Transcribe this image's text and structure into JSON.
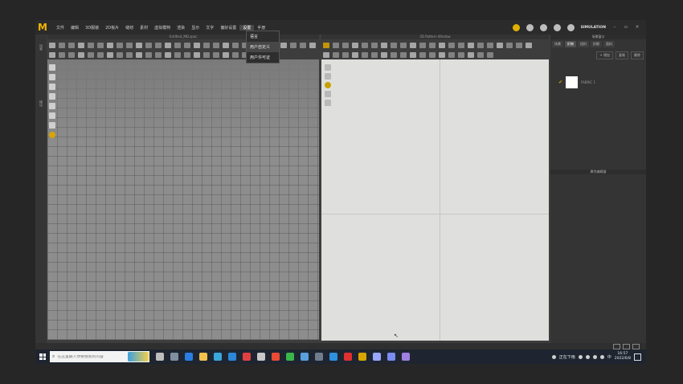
{
  "menubar": {
    "logo": "M",
    "items": [
      "文件",
      "编辑",
      "3D服装",
      "2D板片",
      "缝纫",
      "素材",
      "虚拟模特",
      "渲染",
      "显示",
      "文字",
      "偏好设置",
      "设置",
      "手册"
    ],
    "active_index": 11,
    "simulation_label": "SIMULATION"
  },
  "dropdown": {
    "items": [
      "语言",
      "用户自定义",
      "用户许可证"
    ],
    "highlight_index": 1
  },
  "left_strip": {
    "labels": [
      "场景",
      "模块"
    ]
  },
  "viewport3d": {
    "title": "Untitled_MD.zpac"
  },
  "viewport2d": {
    "title": "2D Pattern Window"
  },
  "right_panel": {
    "title": "场景窗口",
    "tabs": [
      "场景",
      "织物",
      "纽扣",
      "扣眼",
      "面料"
    ],
    "selected_tab": 1,
    "actions": [
      "+ 增加",
      "复制",
      "删除"
    ],
    "item_label": "FABRIC 1",
    "property_title": "属性编辑器"
  },
  "taskbar": {
    "search_placeholder": "在这里输入你要搜索的内容",
    "status_text": "正在下雨",
    "time": "16:57",
    "date": "2022/6/8",
    "lang": "中",
    "app_colors": [
      "#bdbdbd",
      "#7f8fa0",
      "#2a7de1",
      "#f2c14e",
      "#3aa6d9",
      "#2b88d8",
      "#e04040",
      "#c8c8c8",
      "#e94b35",
      "#3ab54a",
      "#5aa0e0",
      "#6f7d8c",
      "#2f8fe0",
      "#e03030",
      "#d9a400",
      "#9aa7ff",
      "#7a8cf0",
      "#a080e0"
    ]
  }
}
